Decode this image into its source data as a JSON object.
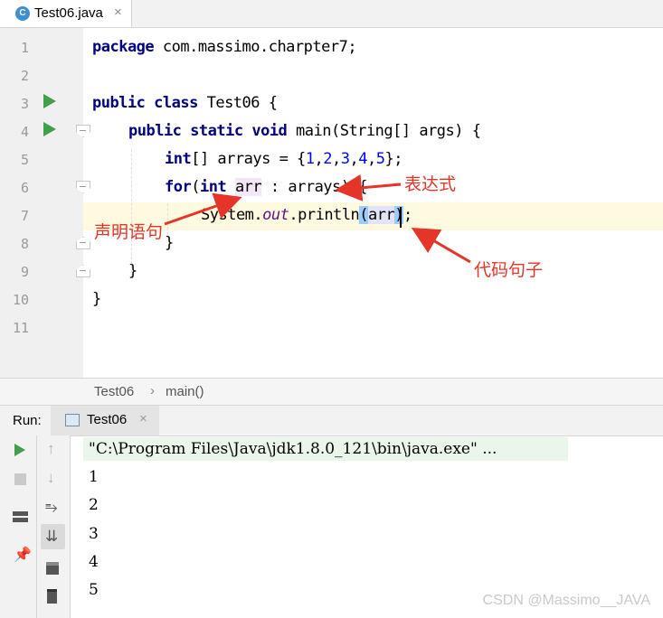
{
  "tab": {
    "icon": "C",
    "label": "Test06.java",
    "close": "×"
  },
  "gutter": {
    "lines": [
      "1",
      "2",
      "3",
      "4",
      "5",
      "6",
      "7",
      "8",
      "9",
      "10",
      "11"
    ]
  },
  "code": {
    "l1": {
      "kw": "package",
      "rest": " com.massimo.charpter7;"
    },
    "l3": {
      "kw1": "public",
      "kw2": "class",
      "rest": " Test06 {"
    },
    "l4": {
      "kw1": "public",
      "kw2": "static",
      "kw3": "void",
      "rest": " main(String[] args) {"
    },
    "l5": {
      "kw": "int",
      "a": "[] arrays = {",
      "n1": "1",
      "c1": ",",
      "n2": "2",
      "c2": ",",
      "n3": "3",
      "c3": ",",
      "n4": "4",
      "c4": ",",
      "n5": "5",
      "end": "};"
    },
    "l6": {
      "kw1": "for",
      "p": "(",
      "kw2": "int",
      "sp": " ",
      "var": "arr",
      "rest": " : arrays) {"
    },
    "l7": {
      "a": "System.",
      "st": "out",
      "b": ".println",
      "p": "(",
      "var": "arr",
      "pc": ")",
      "end": ";"
    },
    "l8": "}",
    "l9": "}",
    "l10": "}"
  },
  "annotations": {
    "expression": "表达式",
    "declaration": "声明语句",
    "code_sentence": "代码句子"
  },
  "breadcrumb": {
    "class": "Test06",
    "sep": "›",
    "method": "main()"
  },
  "run": {
    "label": "Run:",
    "tab": "Test06",
    "close": "×"
  },
  "console": {
    "command": "\"C:\\Program Files\\Java\\jdk1.8.0_121\\bin\\java.exe\" ...",
    "lines": [
      "1",
      "2",
      "3",
      "4",
      "5"
    ]
  },
  "watermark": "CSDN @Massimo__JAVA",
  "colors": {
    "keyword": "#000080",
    "number": "#0000ff",
    "static_field": "#660e7a",
    "annotation": "#e53528",
    "run_green": "#3ea04a"
  }
}
